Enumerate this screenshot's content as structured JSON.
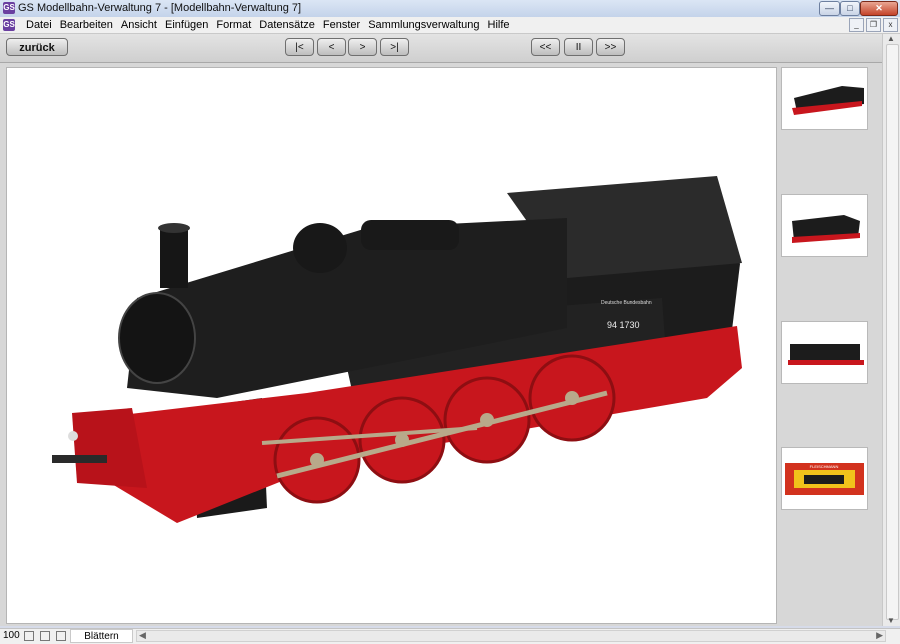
{
  "window": {
    "title": "GS Modellbahn-Verwaltung 7 - [Modellbahn-Verwaltung 7]",
    "app_icon_text": "GS"
  },
  "menu": {
    "items": [
      "Datei",
      "Bearbeiten",
      "Ansicht",
      "Einfügen",
      "Format",
      "Datensätze",
      "Fenster",
      "Sammlungsverwaltung",
      "Hilfe"
    ]
  },
  "toolbar": {
    "back_label": "zurück",
    "first_label": "|<",
    "prev_label": "<",
    "next_label": ">",
    "last_label": ">|",
    "rewind_label": "<<",
    "pause_label": "II",
    "forward_label": ">>"
  },
  "viewer": {
    "locomotive_number": "94 1730",
    "railway_name": "Deutsche Bundesbahn",
    "box_brand": "FLEISCHMANN"
  },
  "statusbar": {
    "zoom": "100",
    "mode": "Blättern"
  },
  "colors": {
    "loco_body": "#1c1c1c",
    "loco_frame": "#c8161d",
    "rods": "#b8a98a",
    "box_red": "#d2321e",
    "box_yellow": "#f1c21b"
  }
}
